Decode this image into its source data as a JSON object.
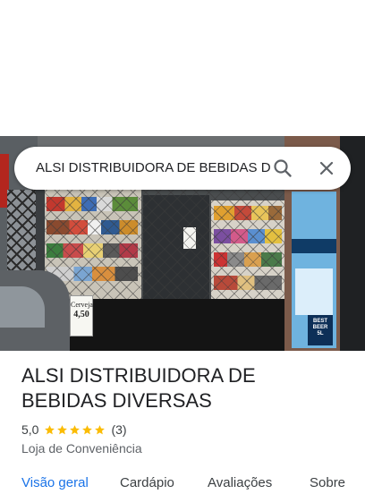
{
  "search": {
    "query": "ALSI DISTRIBUIDORA DE BEBIDAS D",
    "search_icon": "search-icon",
    "close_icon": "close-icon"
  },
  "photo": {
    "price_sign": {
      "line1": "Cerveja",
      "line2": "4,50"
    },
    "poster_text": "BEST BEER 5L"
  },
  "place": {
    "name": "ALSI DISTRIBUIDORA DE BEBIDAS DIVERSAS",
    "rating": "5,0",
    "stars": 5,
    "reviews": "(3)",
    "category": "Loja de Conveniência"
  },
  "tabs": [
    {
      "label": "Visão geral",
      "active": true
    },
    {
      "label": "Cardápio",
      "active": false
    },
    {
      "label": "Avaliações",
      "active": false
    },
    {
      "label": "Sobre",
      "active": false
    }
  ],
  "colors": {
    "accent": "#1a73e8",
    "star": "#fbbc04",
    "text": "#202124",
    "secondary_text": "#5f6368"
  }
}
